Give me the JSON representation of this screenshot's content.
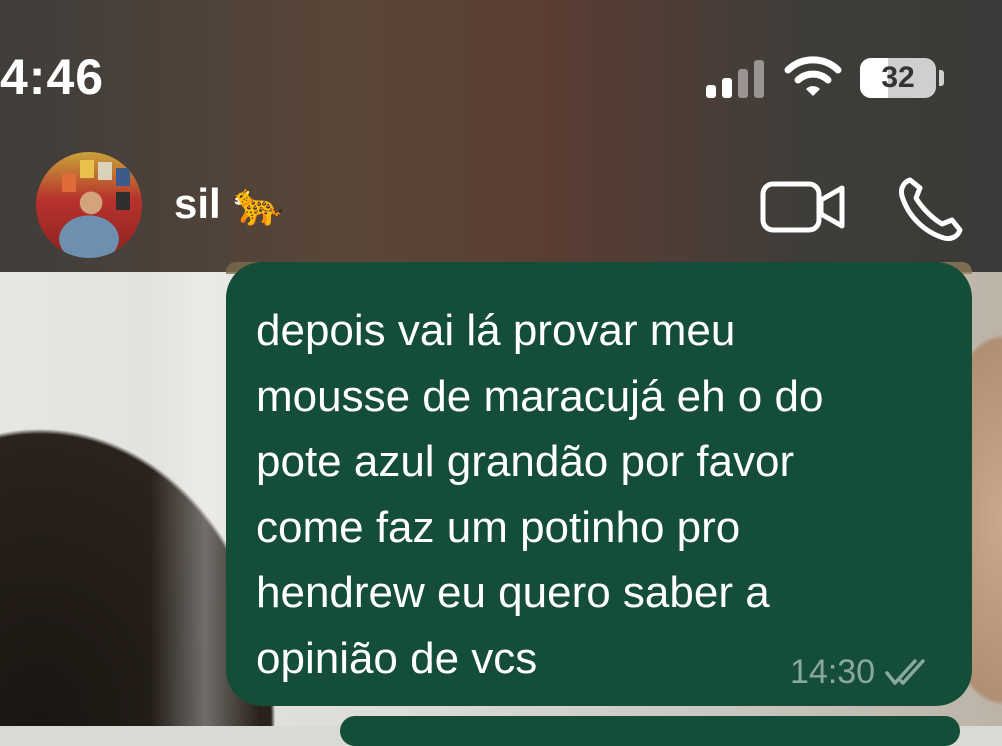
{
  "status_bar": {
    "time": "4:46",
    "battery_level": "32",
    "icons": [
      "cellular-signal-icon",
      "wifi-icon",
      "battery-icon"
    ]
  },
  "chat_header": {
    "contact_name": "sil",
    "contact_emoji": "🐆",
    "actions": [
      "video-call-icon",
      "phone-call-icon"
    ]
  },
  "messages": [
    {
      "direction": "outgoing",
      "text": "depois vai lá provar meu\nmousse de maracujá eh o do\npote azul grandão por favor\ncome faz um potinho pro\nhendrew eu quero saber a\nopinião de vcs",
      "time": "14:30",
      "status_icon": "double-check-icon"
    }
  ],
  "colors": {
    "outgoing_bubble": "#144d38",
    "header_bg": "#4a3c34",
    "meta_text": "#8aa89c"
  }
}
